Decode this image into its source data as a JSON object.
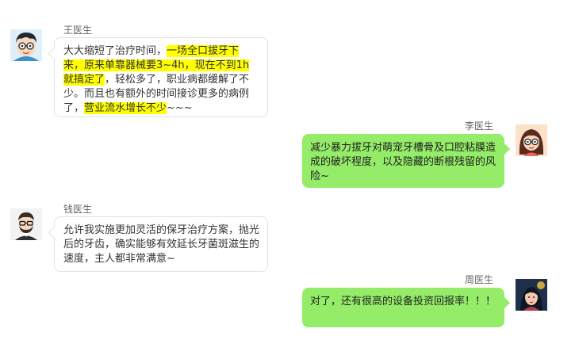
{
  "colors": {
    "bubble_self": "#95ec69",
    "bubble_other": "#ffffff",
    "highlight": "#ffff00"
  },
  "messages": [
    {
      "sender": "王医生",
      "side": "left",
      "avatar_icon": "cartoon-man-glasses-avatar",
      "segments": [
        {
          "text": "大大缩短了治疗时间，",
          "highlight": false
        },
        {
          "text": "一场全口拔牙下来，原来单靠器械要3~4h，现在不到1h就搞定了",
          "highlight": true
        },
        {
          "text": "，轻松多了，职业病都缓解了不少。而且也有额外的时间接诊更多的病例了，",
          "highlight": false
        },
        {
          "text": "营业流水增长不少",
          "highlight": true
        },
        {
          "text": "~~~",
          "highlight": false
        }
      ]
    },
    {
      "sender": "李医生",
      "side": "right",
      "avatar_icon": "cartoon-woman-glasses-avatar",
      "segments": [
        {
          "text": "减少暴力拔牙对萌宠牙槽骨及口腔粘膜造成的破坏程度，以及隐藏的断根残留的风险~",
          "highlight": false
        }
      ]
    },
    {
      "sender": "钱医生",
      "side": "left",
      "avatar_icon": "cartoon-man-beard-avatar",
      "segments": [
        {
          "text": "允许我实施更加灵活的保牙治疗方案，抛光后的牙齿，确实能够有效延长牙菌斑滋生的速度，主人都非常满意~",
          "highlight": false
        }
      ]
    },
    {
      "sender": "周医生",
      "side": "right",
      "avatar_icon": "illustrated-woman-avatar",
      "segments": [
        {
          "text": "对了，还有很高的设备投资回报率！！！",
          "highlight": false
        }
      ]
    }
  ]
}
